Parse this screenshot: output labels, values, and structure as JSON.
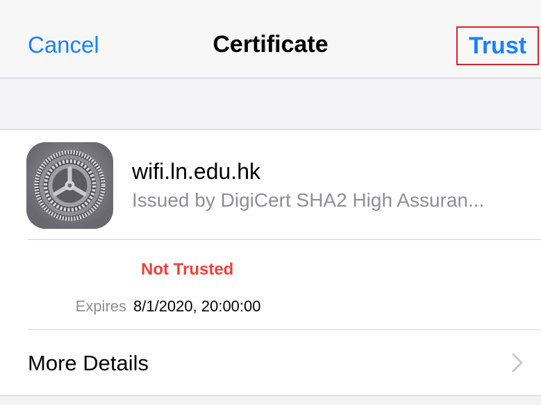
{
  "navbar": {
    "cancel_label": "Cancel",
    "title": "Certificate",
    "trust_label": "Trust"
  },
  "certificate": {
    "icon": "settings-gear-icon",
    "name": "wifi.ln.edu.hk",
    "issuer": "Issued by DigiCert SHA2 High Assuran...",
    "status": "Not Trusted",
    "expires_label": "Expires",
    "expires_value": "8/1/2020, 20:00:00"
  },
  "more_details": {
    "label": "More Details",
    "icon": "chevron-right-icon"
  },
  "colors": {
    "accent": "#1a82fb",
    "status_error": "#f23f38",
    "highlight_border": "#d9202b"
  }
}
